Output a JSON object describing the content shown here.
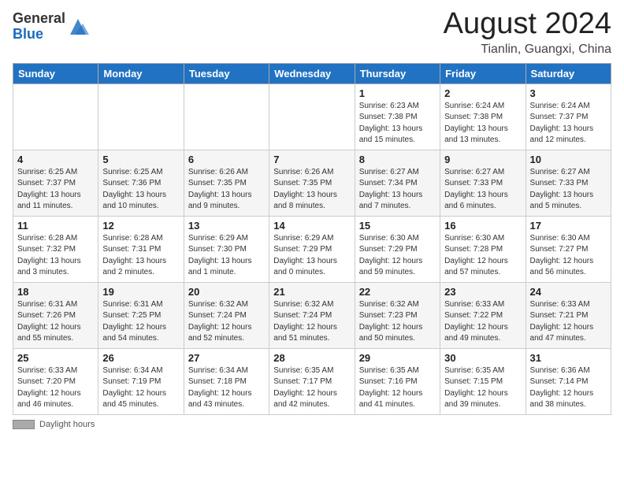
{
  "header": {
    "logo_general": "General",
    "logo_blue": "Blue",
    "month_year": "August 2024",
    "location": "Tianlin, Guangxi, China"
  },
  "days_of_week": [
    "Sunday",
    "Monday",
    "Tuesday",
    "Wednesday",
    "Thursday",
    "Friday",
    "Saturday"
  ],
  "weeks": [
    [
      {
        "num": "",
        "info": ""
      },
      {
        "num": "",
        "info": ""
      },
      {
        "num": "",
        "info": ""
      },
      {
        "num": "",
        "info": ""
      },
      {
        "num": "1",
        "info": "Sunrise: 6:23 AM\nSunset: 7:38 PM\nDaylight: 13 hours\nand 15 minutes."
      },
      {
        "num": "2",
        "info": "Sunrise: 6:24 AM\nSunset: 7:38 PM\nDaylight: 13 hours\nand 13 minutes."
      },
      {
        "num": "3",
        "info": "Sunrise: 6:24 AM\nSunset: 7:37 PM\nDaylight: 13 hours\nand 12 minutes."
      }
    ],
    [
      {
        "num": "4",
        "info": "Sunrise: 6:25 AM\nSunset: 7:37 PM\nDaylight: 13 hours\nand 11 minutes."
      },
      {
        "num": "5",
        "info": "Sunrise: 6:25 AM\nSunset: 7:36 PM\nDaylight: 13 hours\nand 10 minutes."
      },
      {
        "num": "6",
        "info": "Sunrise: 6:26 AM\nSunset: 7:35 PM\nDaylight: 13 hours\nand 9 minutes."
      },
      {
        "num": "7",
        "info": "Sunrise: 6:26 AM\nSunset: 7:35 PM\nDaylight: 13 hours\nand 8 minutes."
      },
      {
        "num": "8",
        "info": "Sunrise: 6:27 AM\nSunset: 7:34 PM\nDaylight: 13 hours\nand 7 minutes."
      },
      {
        "num": "9",
        "info": "Sunrise: 6:27 AM\nSunset: 7:33 PM\nDaylight: 13 hours\nand 6 minutes."
      },
      {
        "num": "10",
        "info": "Sunrise: 6:27 AM\nSunset: 7:33 PM\nDaylight: 13 hours\nand 5 minutes."
      }
    ],
    [
      {
        "num": "11",
        "info": "Sunrise: 6:28 AM\nSunset: 7:32 PM\nDaylight: 13 hours\nand 3 minutes."
      },
      {
        "num": "12",
        "info": "Sunrise: 6:28 AM\nSunset: 7:31 PM\nDaylight: 13 hours\nand 2 minutes."
      },
      {
        "num": "13",
        "info": "Sunrise: 6:29 AM\nSunset: 7:30 PM\nDaylight: 13 hours\nand 1 minute."
      },
      {
        "num": "14",
        "info": "Sunrise: 6:29 AM\nSunset: 7:29 PM\nDaylight: 13 hours\nand 0 minutes."
      },
      {
        "num": "15",
        "info": "Sunrise: 6:30 AM\nSunset: 7:29 PM\nDaylight: 12 hours\nand 59 minutes."
      },
      {
        "num": "16",
        "info": "Sunrise: 6:30 AM\nSunset: 7:28 PM\nDaylight: 12 hours\nand 57 minutes."
      },
      {
        "num": "17",
        "info": "Sunrise: 6:30 AM\nSunset: 7:27 PM\nDaylight: 12 hours\nand 56 minutes."
      }
    ],
    [
      {
        "num": "18",
        "info": "Sunrise: 6:31 AM\nSunset: 7:26 PM\nDaylight: 12 hours\nand 55 minutes."
      },
      {
        "num": "19",
        "info": "Sunrise: 6:31 AM\nSunset: 7:25 PM\nDaylight: 12 hours\nand 54 minutes."
      },
      {
        "num": "20",
        "info": "Sunrise: 6:32 AM\nSunset: 7:24 PM\nDaylight: 12 hours\nand 52 minutes."
      },
      {
        "num": "21",
        "info": "Sunrise: 6:32 AM\nSunset: 7:24 PM\nDaylight: 12 hours\nand 51 minutes."
      },
      {
        "num": "22",
        "info": "Sunrise: 6:32 AM\nSunset: 7:23 PM\nDaylight: 12 hours\nand 50 minutes."
      },
      {
        "num": "23",
        "info": "Sunrise: 6:33 AM\nSunset: 7:22 PM\nDaylight: 12 hours\nand 49 minutes."
      },
      {
        "num": "24",
        "info": "Sunrise: 6:33 AM\nSunset: 7:21 PM\nDaylight: 12 hours\nand 47 minutes."
      }
    ],
    [
      {
        "num": "25",
        "info": "Sunrise: 6:33 AM\nSunset: 7:20 PM\nDaylight: 12 hours\nand 46 minutes."
      },
      {
        "num": "26",
        "info": "Sunrise: 6:34 AM\nSunset: 7:19 PM\nDaylight: 12 hours\nand 45 minutes."
      },
      {
        "num": "27",
        "info": "Sunrise: 6:34 AM\nSunset: 7:18 PM\nDaylight: 12 hours\nand 43 minutes."
      },
      {
        "num": "28",
        "info": "Sunrise: 6:35 AM\nSunset: 7:17 PM\nDaylight: 12 hours\nand 42 minutes."
      },
      {
        "num": "29",
        "info": "Sunrise: 6:35 AM\nSunset: 7:16 PM\nDaylight: 12 hours\nand 41 minutes."
      },
      {
        "num": "30",
        "info": "Sunrise: 6:35 AM\nSunset: 7:15 PM\nDaylight: 12 hours\nand 39 minutes."
      },
      {
        "num": "31",
        "info": "Sunrise: 6:36 AM\nSunset: 7:14 PM\nDaylight: 12 hours\nand 38 minutes."
      }
    ]
  ],
  "footer": {
    "label": "Daylight hours"
  }
}
